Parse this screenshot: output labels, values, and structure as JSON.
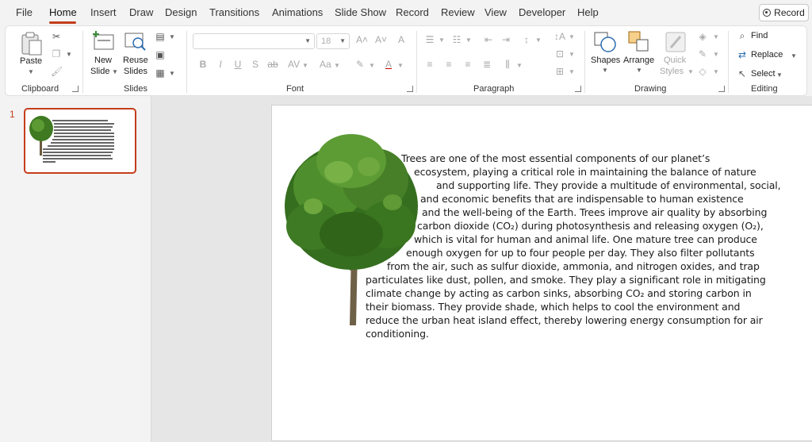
{
  "menu": {
    "tabs": [
      "File",
      "Home",
      "Insert",
      "Draw",
      "Design",
      "Transitions",
      "Animations",
      "Slide Show",
      "Record",
      "Review",
      "View",
      "Developer",
      "Help"
    ],
    "record_button": "Record"
  },
  "ribbon": {
    "clipboard": {
      "label": "Clipboard",
      "paste": "Paste"
    },
    "slides": {
      "label": "Slides",
      "new_slide_1": "New",
      "new_slide_2": "Slide",
      "reuse_1": "Reuse",
      "reuse_2": "Slides"
    },
    "font": {
      "label": "Font",
      "size": "18"
    },
    "paragraph": {
      "label": "Paragraph"
    },
    "drawing": {
      "label": "Drawing",
      "shapes": "Shapes",
      "arrange": "Arrange",
      "quick_styles_1": "Quick",
      "quick_styles_2": "Styles"
    },
    "editing": {
      "label": "Editing",
      "find": "Find",
      "replace": "Replace",
      "select": "Select"
    }
  },
  "thumbnails": {
    "slide_number": "1"
  },
  "slide": {
    "lines": [
      "Trees are one of the most essential components of our planet’s",
      "ecosystem, playing a critical role in maintaining the balance of nature",
      "and supporting life. They provide a multitude of environmental, social,",
      "and economic benefits that are indispensable to human existence",
      "and the well-being of the Earth. Trees improve air quality by absorbing",
      "carbon dioxide (CO₂) during photosynthesis and releasing oxygen (O₂),",
      "which is vital for human and animal life. One mature tree can produce",
      "enough oxygen for up to four people per day. They also filter pollutants",
      "from the air, such as sulfur dioxide, ammonia, and nitrogen oxides, and trap",
      "particulates like dust, pollen, and smoke. They play a significant role in mitigating",
      "climate change by acting as carbon sinks, absorbing CO₂ and storing carbon in",
      "their biomass. They provide shade, which helps to cool the environment and",
      "reduce the urban heat island effect, thereby lowering energy consumption for air",
      "conditioning."
    ]
  }
}
